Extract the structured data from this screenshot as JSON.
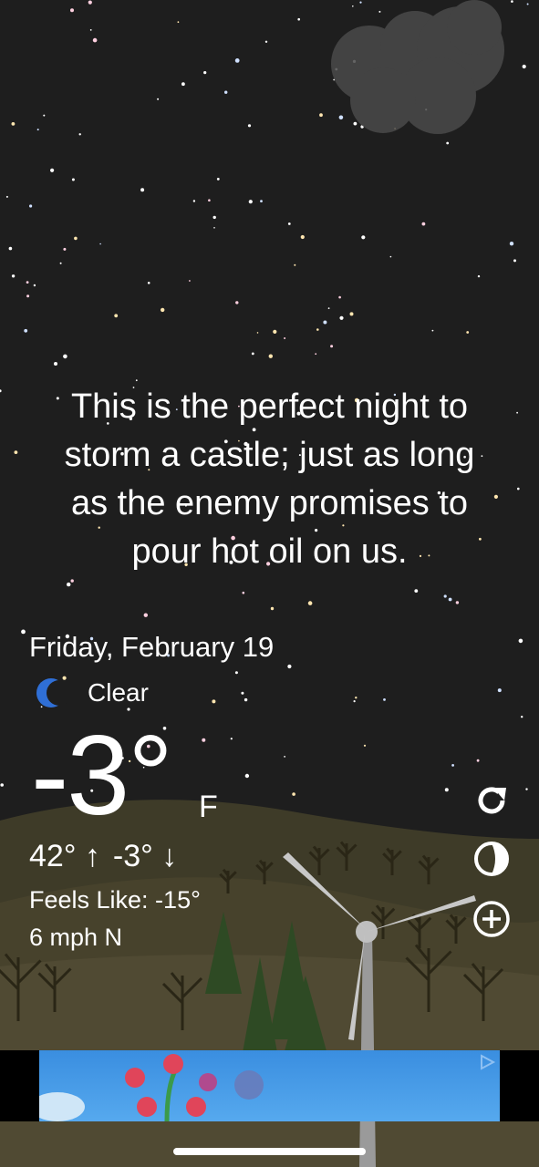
{
  "quote": {
    "lines": [
      "This is the perfect night to",
      "storm a castle; just as long",
      "as the enemy promises to",
      "pour hot oil on us."
    ]
  },
  "weather": {
    "date": "Friday, February 19",
    "condition": "Clear",
    "condition_icon": "moon-icon",
    "temperature": "-3°",
    "unit": "F",
    "high": "42° ↑",
    "low": "-3° ↓",
    "feels_like": "Feels Like: -15°",
    "wind": "6 mph N"
  },
  "actions": {
    "refresh_icon": "refresh-icon",
    "theme_icon": "theme-icon",
    "add_icon": "add-location-icon"
  },
  "ad": {
    "badge_icon": "ad-choices-icon"
  },
  "colors": {
    "sky": "#1e1e1e",
    "hill_back": "#3d3a26",
    "hill_front": "#4a4530",
    "moon": "#2f6fd6",
    "ad_blue": "#3a8ee0"
  }
}
